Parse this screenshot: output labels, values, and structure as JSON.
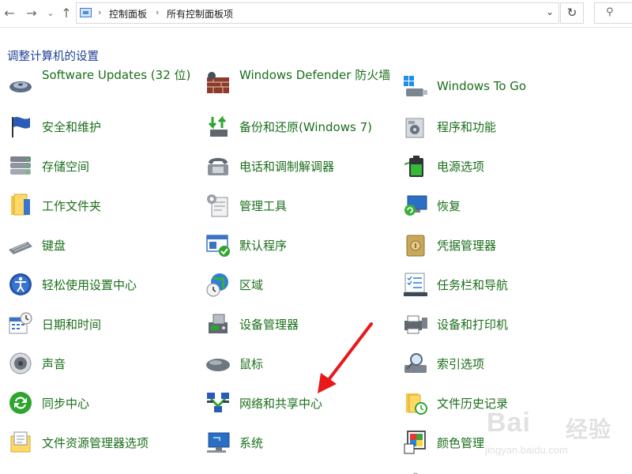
{
  "breadcrumb": {
    "root": "控制面板",
    "current": "所有控制面板项"
  },
  "heading": "调整计算机的设置",
  "items": {
    "software_updates": "Software Updates (32 位)",
    "windows_defender": "Windows Defender 防火墙",
    "windows_to_go": "Windows To Go",
    "security_maintenance": "安全和维护",
    "backup_restore": "备份和还原(Windows 7)",
    "programs_features": "程序和功能",
    "storage_spaces": "存储空间",
    "phone_modem": "电话和调制解调器",
    "power_options": "电源选项",
    "work_folders": "工作文件夹",
    "admin_tools": "管理工具",
    "recovery": "恢复",
    "keyboard": "键盘",
    "default_programs": "默认程序",
    "credential_manager": "凭据管理器",
    "ease_of_access": "轻松使用设置中心",
    "region": "区域",
    "taskbar_navigation": "任务栏和导航",
    "date_time": "日期和时间",
    "device_manager": "设备管理器",
    "devices_printers": "设备和打印机",
    "sound": "声音",
    "mouse": "鼠标",
    "indexing_options": "索引选项",
    "sync_center": "同步中心",
    "network_sharing": "网络和共享中心",
    "file_history": "文件历史记录",
    "explorer_options": "文件资源管理器选项",
    "system": "系统",
    "color_management": "颜色管理"
  },
  "watermark": {
    "brand": "Bai",
    "brand2": "经验",
    "url": "jingyan.baidu.com"
  },
  "colors": {
    "link": "#1b6e1b",
    "heading": "#1c3f95",
    "arrow": "#e8181b"
  }
}
